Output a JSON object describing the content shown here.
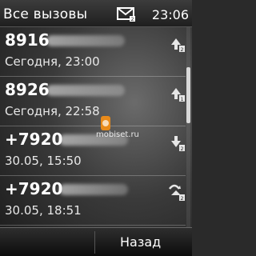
{
  "status": {
    "title": "Все вызовы",
    "time": "23:06",
    "message_icon": "message-envelope-icon"
  },
  "calls": [
    {
      "number": "8916",
      "when": "Сегодня, 23:00",
      "type": "outgoing",
      "icon": "outgoing-call-icon"
    },
    {
      "number": "8926",
      "when": "Сегодня, 22:58",
      "type": "outgoing",
      "icon": "outgoing-call-icon"
    },
    {
      "number": "+7920",
      "when": "30.05, 15:50",
      "type": "received",
      "icon": "received-call-icon"
    },
    {
      "number": "+7920",
      "when": "30.05, 18:51",
      "type": "missed",
      "icon": "missed-call-icon"
    }
  ],
  "watermark": {
    "text": "mobiset.ru"
  },
  "softkeys": {
    "right_label": "Назад"
  }
}
